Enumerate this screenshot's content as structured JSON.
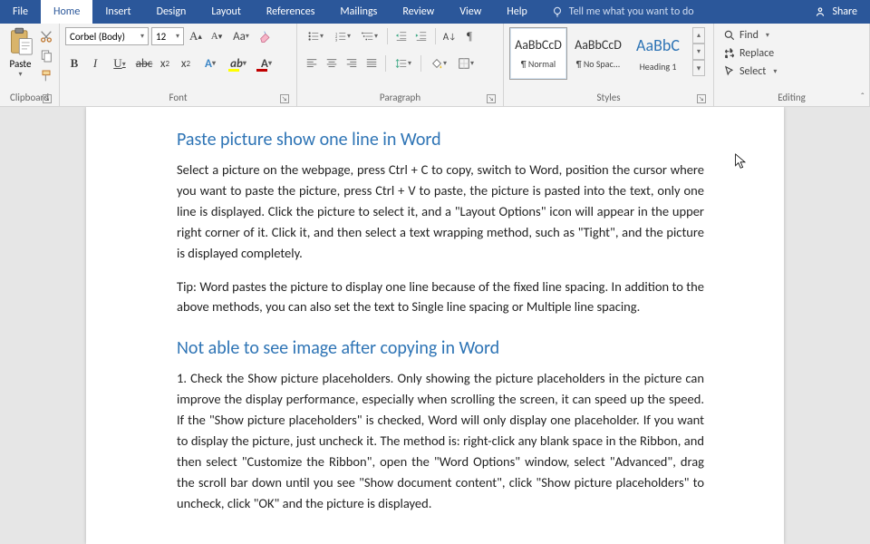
{
  "menu": {
    "file": "File",
    "home": "Home",
    "insert": "Insert",
    "design": "Design",
    "layout": "Layout",
    "references": "References",
    "mailings": "Mailings",
    "review": "Review",
    "view": "View",
    "help": "Help",
    "tell_me": "Tell me what you want to do",
    "share": "Share"
  },
  "ribbon": {
    "clipboard": {
      "label": "Clipboard",
      "paste": "Paste"
    },
    "font": {
      "label": "Font",
      "name": "Corbel (Body)",
      "size": "12"
    },
    "paragraph": {
      "label": "Paragraph"
    },
    "styles": {
      "label": "Styles",
      "items": [
        {
          "preview": "AaBbCcD",
          "name": "¶ Normal"
        },
        {
          "preview": "AaBbCcD",
          "name": "¶ No Spac..."
        },
        {
          "preview": "AaBbC",
          "name": "Heading 1"
        }
      ]
    },
    "editing": {
      "label": "Editing",
      "find": "Find",
      "replace": "Replace",
      "select": "Select"
    }
  },
  "doc": {
    "h1": "Paste picture show one line in Word",
    "p1": "Select a picture on the webpage, press Ctrl + C to copy, switch to Word, position the cursor where you want to paste the picture, press Ctrl + V to paste, the picture is pasted into the text, only one line is displayed. Click the picture to select it, and a \"Layout Options\" icon will appear in the upper right corner of it. Click it, and then select a text wrapping method, such as \"Tight\", and the picture is displayed completely.",
    "p2": "Tip: Word pastes the picture to display one line because of the fixed line spacing. In addition to the above methods, you can also set the text to Single line spacing or Multiple line spacing.",
    "h2": "Not able to see image after copying in Word",
    "p3": "1. Check the Show picture placeholders. Only showing the picture placeholders in the picture can improve the display performance, especially when scrolling the screen, it can speed up the speed. If the \"Show picture placeholders\" is checked, Word will only display one placeholder. If you want to display the picture, just uncheck it. The method is: right-click any blank space in the Ribbon, and then select \"Customize the Ribbon\", open the \"Word Options\" window, select \"Advanced\", drag the scroll bar down until you see \"Show document content\", click \"Show picture placeholders\" to uncheck, click \"OK\" and the picture is displayed."
  }
}
